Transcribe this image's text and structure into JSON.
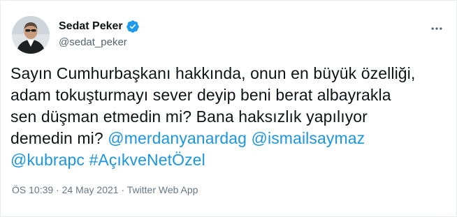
{
  "user": {
    "name": "Sedat Peker",
    "handle": "@sedat_peker",
    "verified": true
  },
  "tweet": {
    "lines": [
      [
        {
          "text": "Sayın Cumhurbaşkanı hakkında, onun en büyük özelliği,",
          "type": "text"
        }
      ],
      [
        {
          "text": "adam tokuşturmayı sever deyip beni berat albayrakla",
          "type": "text"
        }
      ],
      [
        {
          "text": "sen düşman etmedin mi? Bana haksızlık yapılıyor",
          "type": "text"
        }
      ],
      [
        {
          "text": "demedin mi? ",
          "type": "text"
        },
        {
          "text": "@merdanyanardag",
          "type": "mention"
        },
        {
          "text": " ",
          "type": "text"
        },
        {
          "text": "@ismailsaymaz",
          "type": "mention"
        }
      ],
      [
        {
          "text": "@kubrapc",
          "type": "mention"
        },
        {
          "text": " ",
          "type": "text"
        },
        {
          "text": "#AçıkveNetÖzel",
          "type": "hashtag"
        }
      ]
    ]
  },
  "meta": {
    "time": "ÖS 10:39",
    "separator1": " · ",
    "date": "24 May 2021",
    "separator2": " · ",
    "source": "Twitter Web App"
  },
  "colors": {
    "link": "#1b95e0",
    "verified": "#1d9bf0",
    "text": "#0f1419",
    "secondary": "#657786"
  },
  "icons": {
    "verified": "verified-badge-icon",
    "more": "more-horizontal-icon"
  }
}
